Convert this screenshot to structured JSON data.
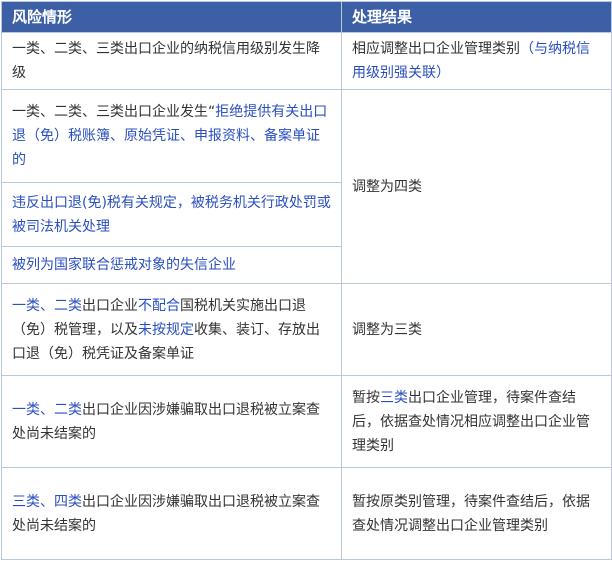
{
  "colors": {
    "header_bg": "#3d5fa6",
    "header_text": "#ffffff",
    "highlight": "#2a4fc0",
    "body_text": "#333333",
    "border": "#b7c9dd"
  },
  "header": {
    "col1": "风险情形",
    "col2": "处理结果"
  },
  "rows": [
    {
      "situation": [
        {
          "t": "一类、二类、三类出口企业的纳税信用级别发生降级",
          "hl": false
        }
      ],
      "result": [
        {
          "t": "相应调整出口企业管理类别",
          "hl": false
        },
        {
          "t": "（与纳税信用级别强关联）",
          "hl": true
        }
      ]
    },
    {
      "situation": [
        {
          "t": "一类、二类、三类出口企业发生“",
          "hl": false
        },
        {
          "t": "拒绝提供有关出口退（免）税账簿、原始凭证、申报资料、备案单证的",
          "hl": true
        }
      ],
      "result": [
        {
          "t": "调整为四类",
          "hl": false
        }
      ]
    },
    {
      "situation": [
        {
          "t": "违反出口退(免)税有关规定，被税务机关行政处罚或被司法机关处理",
          "hl": true
        }
      ]
    },
    {
      "situation": [
        {
          "t": "被列为国家联合惩戒对象的失信企业",
          "hl": true
        }
      ]
    },
    {
      "situation": [
        {
          "t": "一类、二类",
          "hl": true
        },
        {
          "t": "出口企业",
          "hl": false
        },
        {
          "t": "不配合",
          "hl": true
        },
        {
          "t": "国税机关实施出口退（免）税管理，以及",
          "hl": false
        },
        {
          "t": "未按规定",
          "hl": true
        },
        {
          "t": "收集、装订、存放出口退（免）税凭证及备案单证",
          "hl": false
        }
      ],
      "result": [
        {
          "t": "调整为三类",
          "hl": false
        }
      ]
    },
    {
      "situation": [
        {
          "t": "一类、二类",
          "hl": true
        },
        {
          "t": "出口企业因涉嫌骗取出口退税被立案查处尚未结案的",
          "hl": false
        }
      ],
      "result": [
        {
          "t": "暂按",
          "hl": false
        },
        {
          "t": "三类",
          "hl": true
        },
        {
          "t": "出口企业管理，待案件查结后，依据查处情况相应调整出口企业管理类别",
          "hl": false
        }
      ]
    },
    {
      "situation": [
        {
          "t": "三类、四类",
          "hl": true
        },
        {
          "t": "出口企业因涉嫌骗取出口退税被立案查处尚未结案的",
          "hl": false
        }
      ],
      "result": [
        {
          "t": "暂按原类别管理，待案件查结后，依据查处情况调整出口企业管理类别",
          "hl": false
        }
      ]
    }
  ]
}
